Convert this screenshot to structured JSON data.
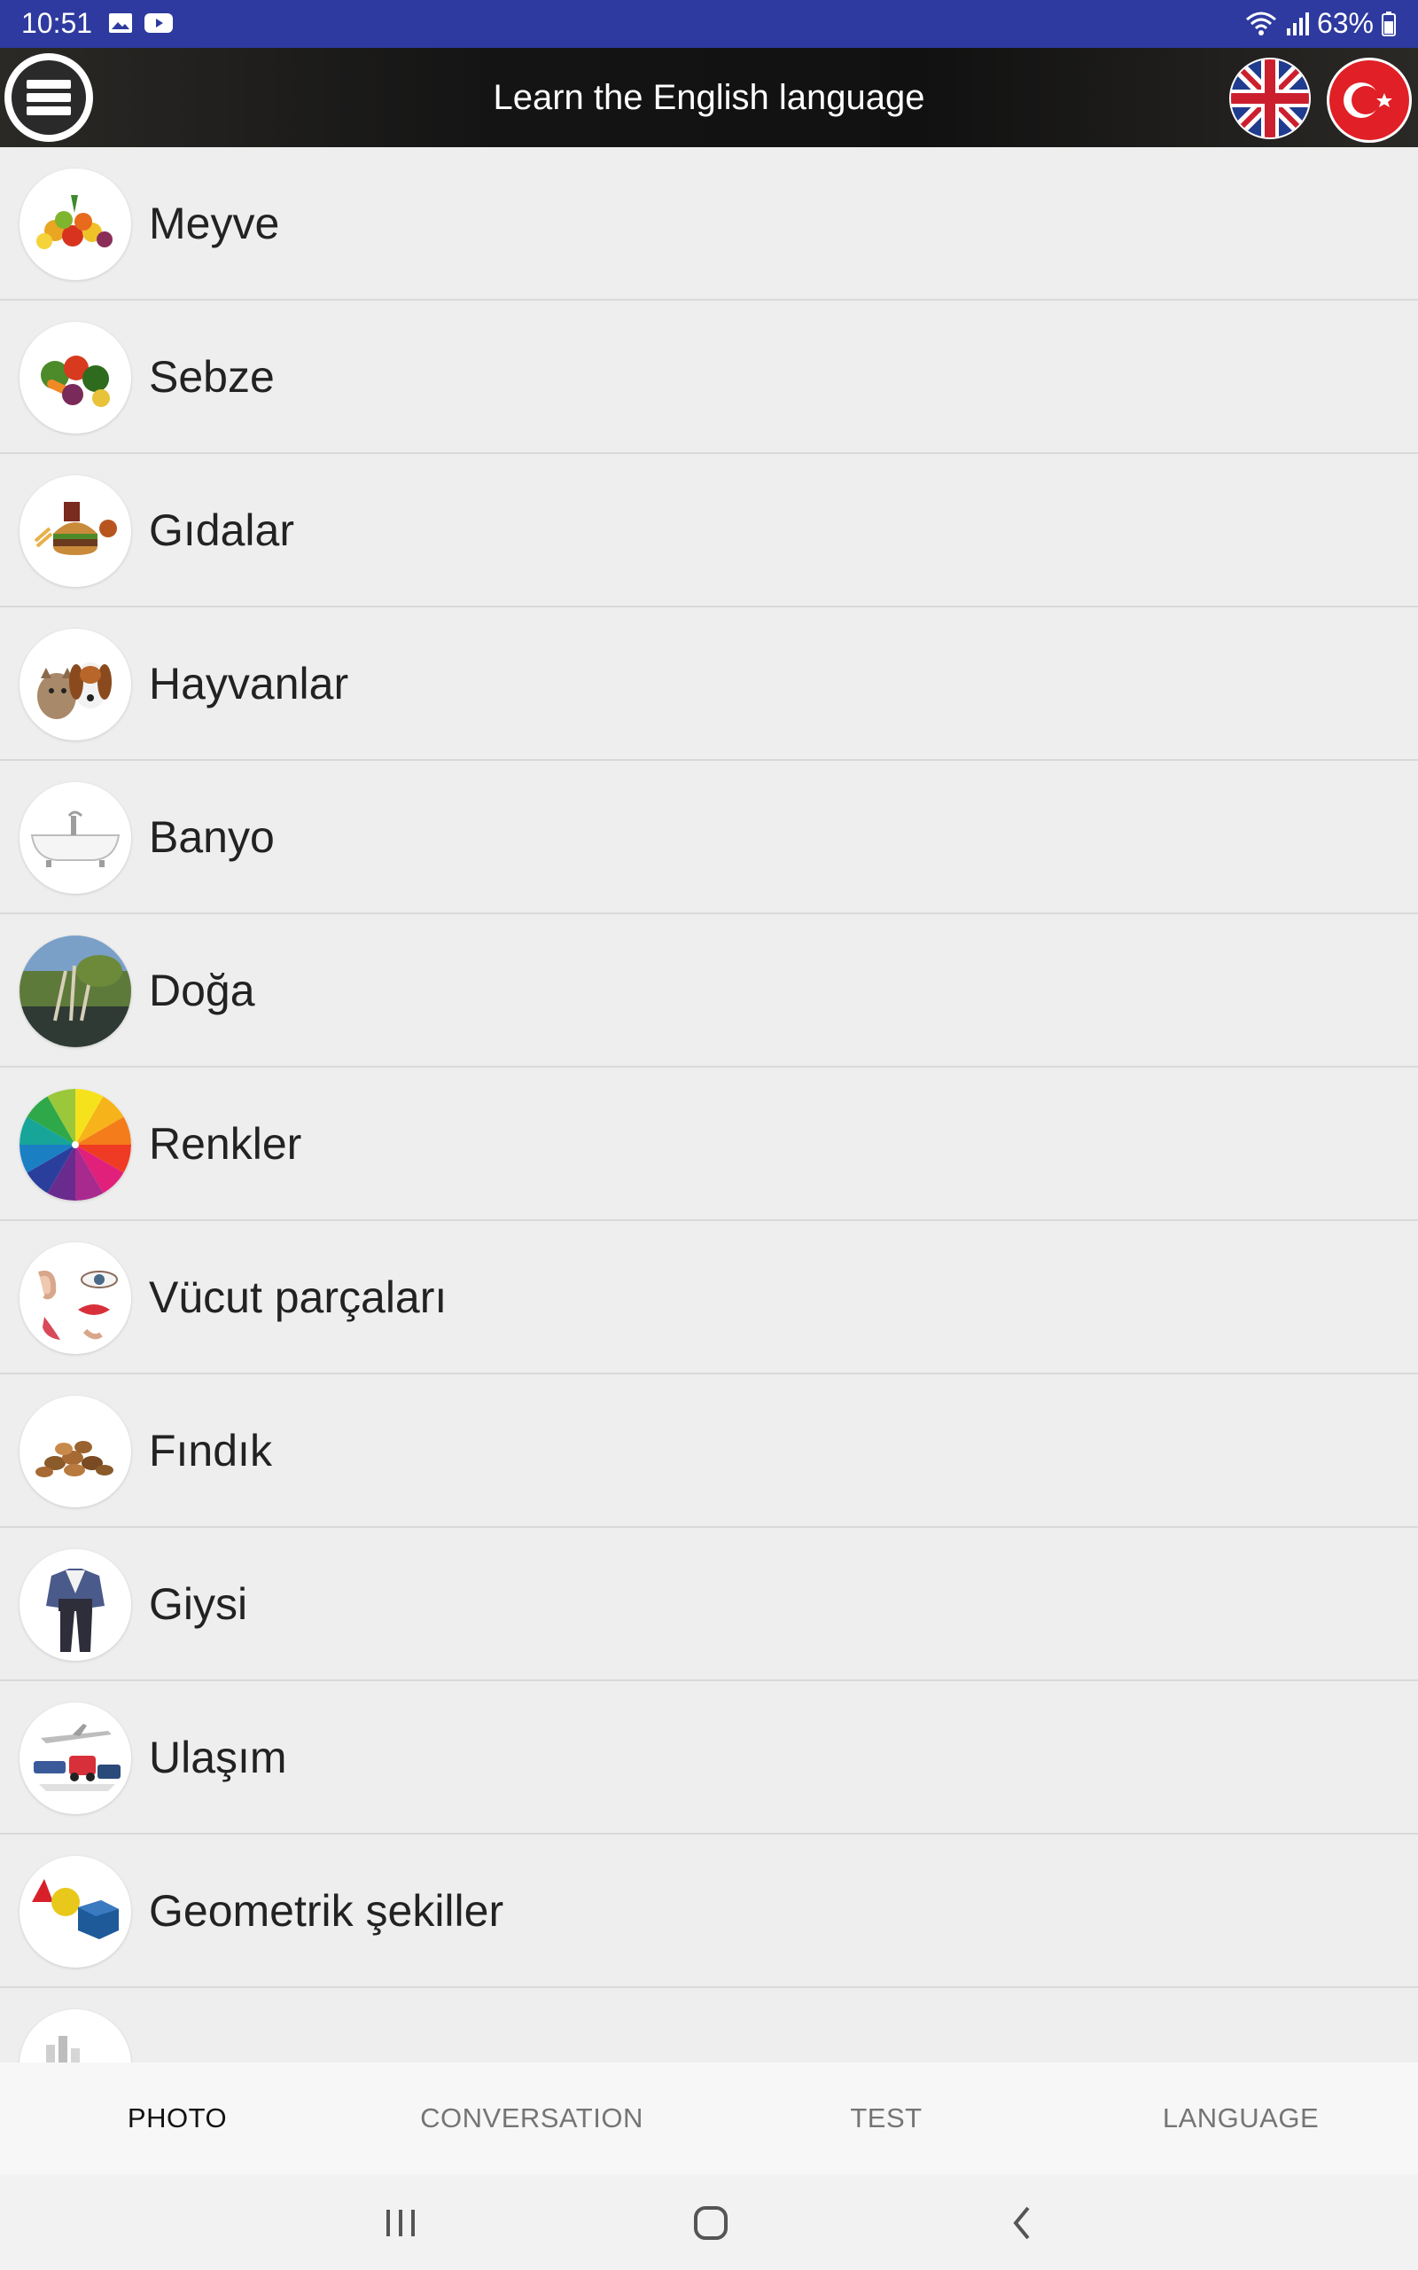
{
  "status_bar": {
    "time": "10:51",
    "battery": "63%",
    "icons": [
      "gallery-icon",
      "youtube-icon",
      "wifi-icon",
      "signal-icon",
      "battery-icon"
    ]
  },
  "app_bar": {
    "title": "Learn the English language",
    "menu_icon": "hamburger-menu-icon",
    "flags": [
      "uk-flag-icon",
      "turkey-flag-icon"
    ]
  },
  "categories": [
    {
      "label": "Meyve",
      "icon": "fruit-icon"
    },
    {
      "label": "Sebze",
      "icon": "vegetable-icon"
    },
    {
      "label": "Gıdalar",
      "icon": "food-icon"
    },
    {
      "label": "Hayvanlar",
      "icon": "animals-icon"
    },
    {
      "label": "Banyo",
      "icon": "bathtub-icon"
    },
    {
      "label": "Doğa",
      "icon": "nature-icon"
    },
    {
      "label": "Renkler",
      "icon": "color-wheel-icon"
    },
    {
      "label": "Vücut parçaları",
      "icon": "body-parts-icon"
    },
    {
      "label": "Fındık",
      "icon": "nuts-icon"
    },
    {
      "label": "Giysi",
      "icon": "clothes-icon"
    },
    {
      "label": "Ulaşım",
      "icon": "transport-icon"
    },
    {
      "label": "Geometrik şekiller",
      "icon": "shapes-icon"
    },
    {
      "label": "",
      "icon": "city-icon"
    }
  ],
  "tabs": [
    {
      "label": "PHOTO",
      "active": true
    },
    {
      "label": "CONVERSATION",
      "active": false
    },
    {
      "label": "TEST",
      "active": false
    },
    {
      "label": "LANGUAGE",
      "active": false
    }
  ],
  "colors": {
    "status_bar": "#2e3a9f",
    "list_background": "#eeeeee",
    "divider": "#d9d9d9"
  }
}
